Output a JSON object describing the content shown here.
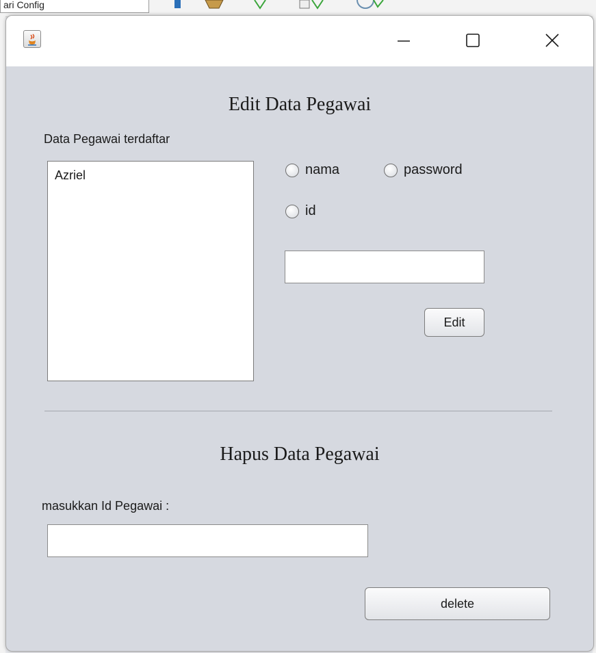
{
  "background": {
    "toolbar_field_text": "ari Config"
  },
  "window": {
    "app_icon": "java-cup-icon",
    "controls": {
      "minimize": "—",
      "maximize": "☐",
      "close": "✕"
    }
  },
  "edit_section": {
    "title": "Edit Data Pegawai",
    "list_label": "Data Pegawai terdaftar",
    "list_items": [
      "Azriel"
    ],
    "radio_options": {
      "nama": "nama",
      "password": "password",
      "id": "id"
    },
    "input_value": "",
    "edit_button": "Edit"
  },
  "delete_section": {
    "title": "Hapus Data Pegawai",
    "id_label": "masukkan Id Pegawai :",
    "input_value": "",
    "delete_button": "delete"
  }
}
